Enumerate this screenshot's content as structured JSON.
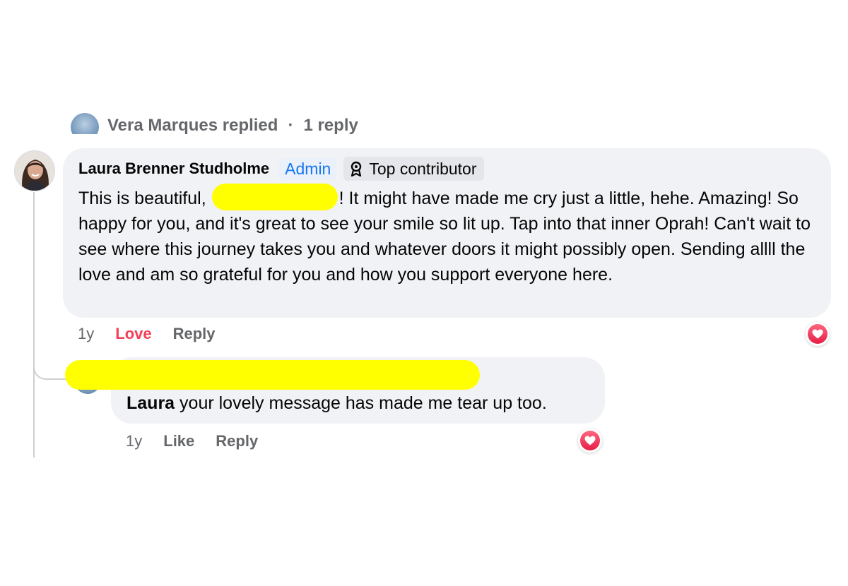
{
  "previous": {
    "text": "Vera Marques replied",
    "separator": "·",
    "count": "1 reply"
  },
  "comment": {
    "author": "Laura Brenner Studholme",
    "admin_label": "Admin",
    "contributor_label": "Top contributor",
    "text_before": "This is beautiful,",
    "text_after": "! It might have made me cry just a little, hehe. Amazing! So happy for you, and it's great to see your smile so lit up. Tap into that inner Oprah! Can't wait to see where this journey takes you and whatever doors it might possibly open. Sending allll the love and am so grateful for you and how you support everyone here.",
    "time": "1y",
    "reaction_label": "Love",
    "reply_label": "Reply",
    "reaction_icon": "heart-icon"
  },
  "reply": {
    "mention": "Laura",
    "text": "your lovely message has made me tear up too.",
    "time": "1y",
    "like_label": "Like",
    "reply_label": "Reply",
    "reaction_icon": "heart-icon"
  },
  "colors": {
    "bubble": "#f0f2f5",
    "admin_blue": "#1877f2",
    "love_red": "#f33e58",
    "redaction_yellow": "#ffff00",
    "muted_text": "#65676b"
  }
}
